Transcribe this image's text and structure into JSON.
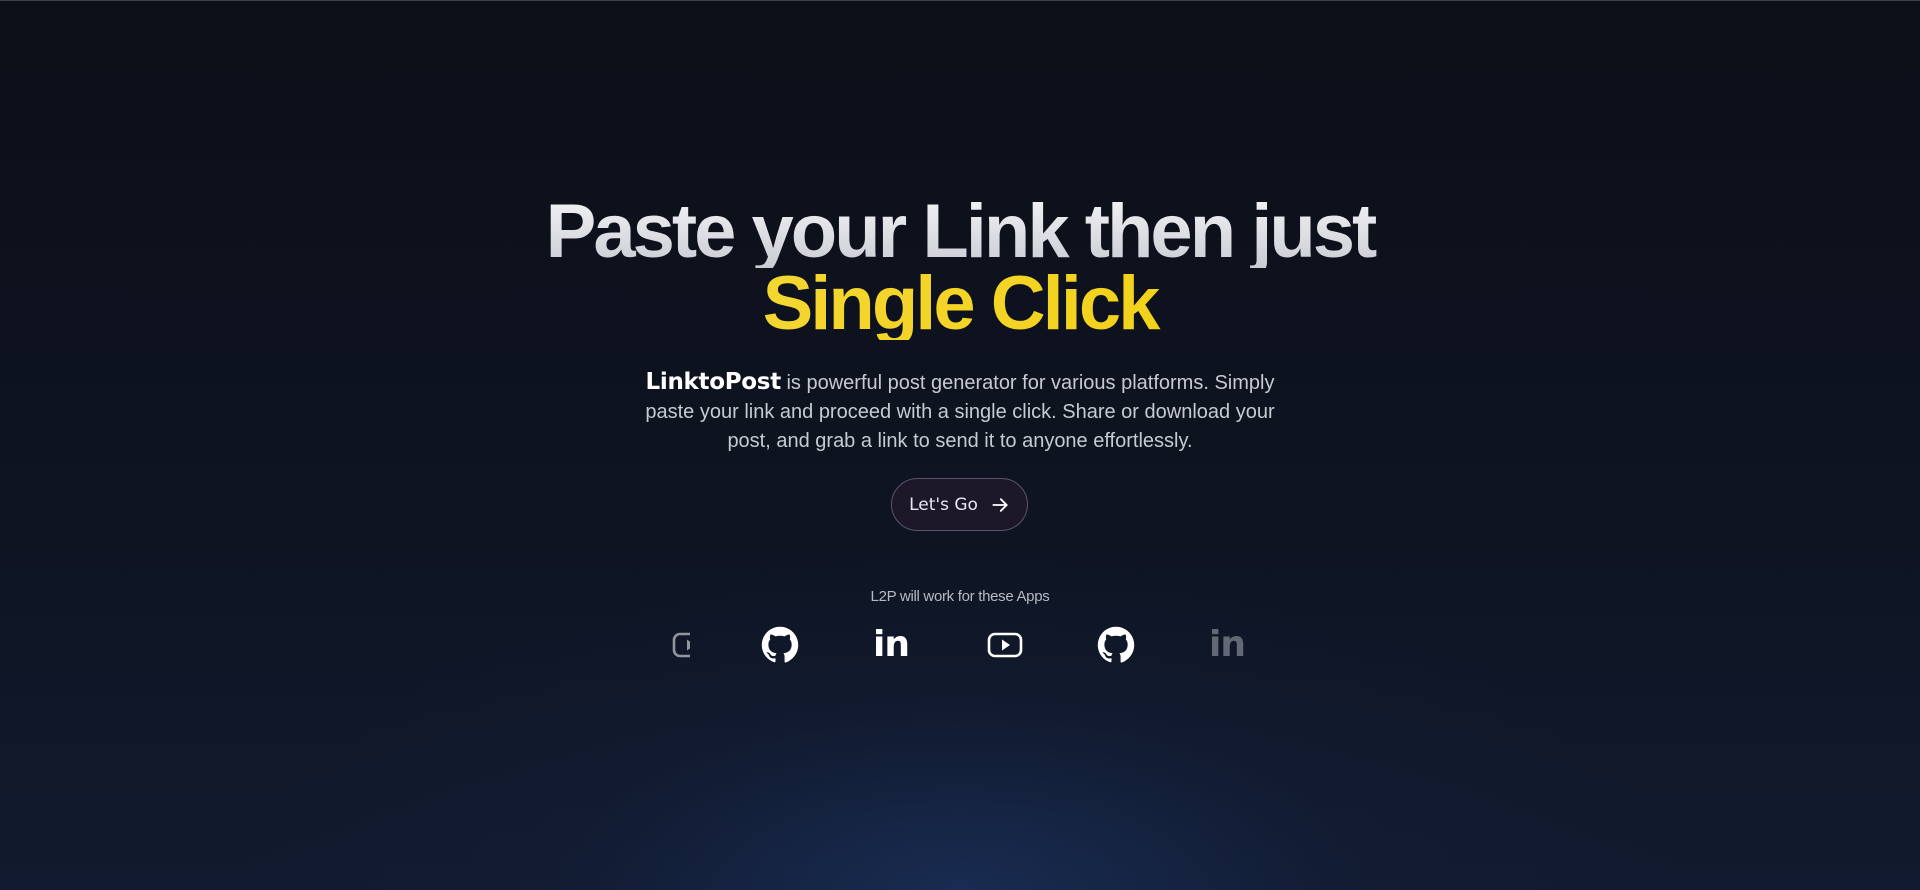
{
  "hero": {
    "headline_line1": "Paste your Link then just",
    "headline_line2": "Single Click",
    "brand": "LinktoPost",
    "description": "is powerful post generator for various platforms. Simply paste your link and proceed with a single click. Share or download your post, and grab a link to send it to anyone effortlessly.",
    "cta_label": "Let's Go"
  },
  "apps": {
    "label": "L2P will work for these Apps",
    "icons": [
      "youtube-icon",
      "github-icon",
      "linkedin-icon",
      "youtube-icon",
      "github-icon",
      "linkedin-icon"
    ],
    "linkedin_text": "in"
  },
  "colors": {
    "background": "#0b0f1a",
    "headline": "#e4e6ea",
    "accent_yellow": "#f3d21c",
    "cta_background": "#1c1829",
    "cta_border": "#5a5468"
  }
}
